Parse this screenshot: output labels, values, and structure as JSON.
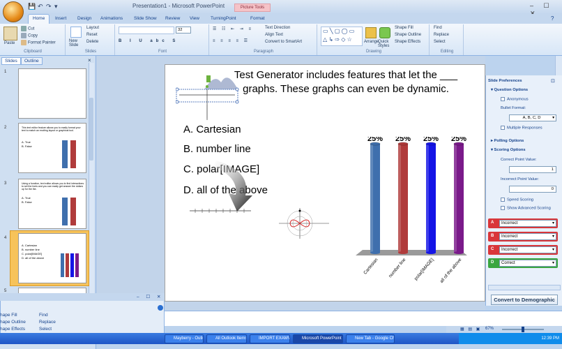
{
  "titlebar": {
    "title": "Presentation1 - Microsoft PowerPoint",
    "context_tab": "Picture Tools",
    "controls": "– ☐ ✕"
  },
  "tabs": [
    "Home",
    "Insert",
    "Design",
    "Animations",
    "Slide Show",
    "Review",
    "View",
    "TurningPoint",
    "Format"
  ],
  "ribbon": {
    "clipboard": {
      "label": "Clipboard",
      "cut": "Cut",
      "copy": "Copy",
      "paste": "Paste",
      "format_painter": "Format Painter"
    },
    "slides": {
      "label": "Slides",
      "new_slide": "New Slide",
      "layout": "Layout",
      "reset": "Reset",
      "delete": "Delete"
    },
    "font": {
      "label": "Font",
      "size": "32"
    },
    "paragraph": {
      "label": "Paragraph",
      "text_direction": "Text Direction",
      "align_text": "Align Text",
      "convert": "Convert to SmartArt"
    },
    "drawing": {
      "label": "Drawing",
      "arrange": "Arrange",
      "quick_styles": "Quick Styles",
      "shape_fill": "Shape Fill",
      "shape_outline": "Shape Outline",
      "shape_effects": "Shape Effects"
    },
    "editing": {
      "label": "Editing",
      "find": "Find",
      "replace": "Replace",
      "select": "Select"
    }
  },
  "leftpane": {
    "tabs": [
      "Slides",
      "Outline"
    ],
    "slide_numbers": [
      "1",
      "2",
      "3",
      "4",
      "5"
    ],
    "thumb2_text": "This text editor feature allows you to easily format your text to match an exciting layout or graphical tool.",
    "thumb2_a": "A. True",
    "thumb2_b": "B. False",
    "thumb3_text": "Using a function, text editor allows you to find interactions to set the fonts and you can easily get answer the dollars up for the the.",
    "thumb3_a": "A. True",
    "thumb3_b": "B. False"
  },
  "slide": {
    "title": "Test Generator includes features that let the ___ graphs. These graphs can even be dynamic.",
    "answers": [
      "A. Cartesian",
      "B. number line",
      "C. polar[IMAGE]",
      "D. all of the above"
    ],
    "chart_data": {
      "type": "bar",
      "categories": [
        "Cartesian",
        "number line",
        "polar[IMAGE]",
        "all of the above"
      ],
      "values": [
        25,
        25,
        25,
        25
      ],
      "value_labels": [
        "25%",
        "25%",
        "25%",
        "25%"
      ],
      "colors": [
        "#3f6fad",
        "#b03b3b",
        "#1414e6",
        "#7a1a8a"
      ],
      "ylim": [
        0,
        25
      ]
    }
  },
  "rightpane": {
    "header": "Slide Preferences",
    "question_options": "Question Options",
    "anonymous": "Anonymous",
    "bullet_format": "Bullet Format:",
    "bullet_value": "A, B, C, D",
    "multiple_responses": "Multiple Responses",
    "polling_options": "Polling Options",
    "scoring_options": "Scoring Options",
    "correct_point_value": "Correct Point Value:",
    "correct_value": "1",
    "incorrect_point_value": "Incorrect Point Value:",
    "incorrect_value": "0",
    "speed_scoring": "Speed Scoring",
    "show_advanced": "Show Advanced Scoring",
    "answers": [
      {
        "letter": "A",
        "value": "Incorrect",
        "color": "#d9363a"
      },
      {
        "letter": "B",
        "value": "Incorrect",
        "color": "#d9363a"
      },
      {
        "letter": "C",
        "value": "Incorrect",
        "color": "#d9363a"
      },
      {
        "letter": "D",
        "value": "Correct",
        "color": "#3aa640"
      }
    ],
    "convert_button": "Convert to Demographic"
  },
  "popup": {
    "shape_fill": "hape Fill",
    "shape_outline": "hape Outline",
    "shape_effects": "hape Effects",
    "find": "Find",
    "replace": "Replace",
    "select": "Select",
    "controls": "– ☐ ✕"
  },
  "statusbar": {
    "zoom": "67%"
  },
  "taskbar": {
    "items": [
      "Mayberry - Outlo...",
      "All Outlook Items - Mi...",
      "IMPORT EXAMVIEW...",
      "Microsoft PowerPoint ...",
      "New Tab - Google Ch..."
    ],
    "time": "12:39 PM"
  }
}
